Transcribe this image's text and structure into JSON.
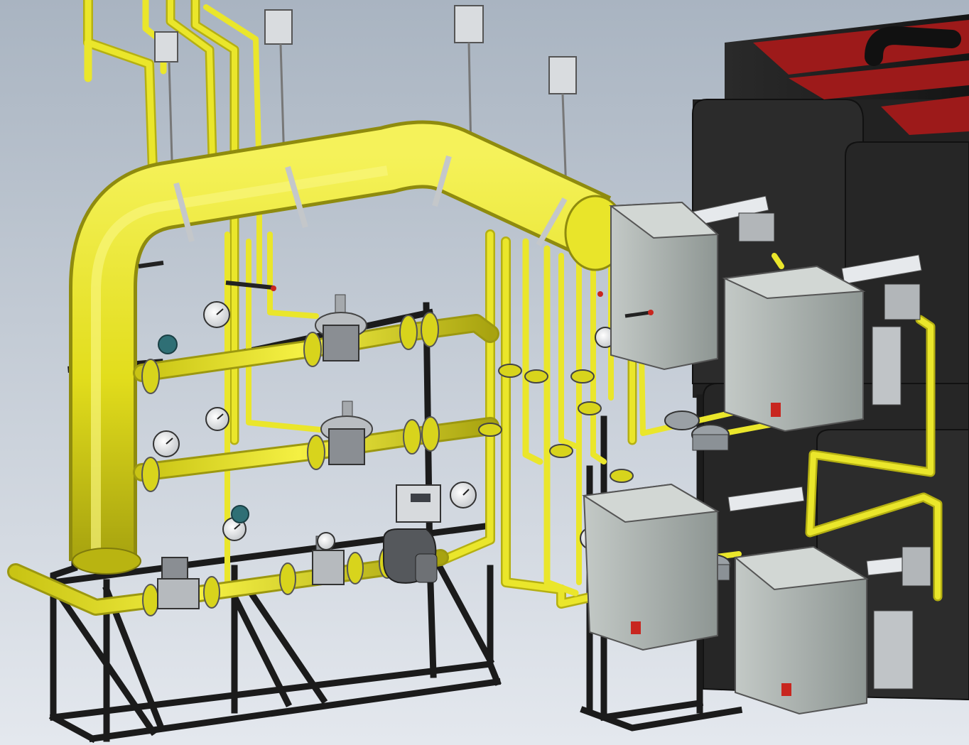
{
  "title": "",
  "colors": {
    "background_top": "#a9b4c1",
    "background_bottom": "#e4e8ee",
    "gas_pipe": "#e6e21a",
    "gas_pipe_dark": "#a09c10",
    "steel_frame": "#1b1b1b",
    "burner_housing": "#9aa29f",
    "burner_housing_light": "#b9c0bd",
    "boiler_body": "#1e1e1e",
    "boiler_top_panel": "#9d1a1a",
    "valve_body": "#8a8e93",
    "gauge_face": "#f3f3f3",
    "indicator_red": "#c8261f"
  },
  "components": {
    "header_pipe": "header-pipe",
    "regulator_lines": [
      "regulator-line-upper",
      "regulator-line-middle",
      "regulator-line-lower"
    ],
    "burners": [
      "burner-1",
      "burner-2",
      "burner-3",
      "burner-4"
    ],
    "boilers": [
      "boiler-upper",
      "boiler-lower"
    ],
    "hangers": [
      "hanger-1",
      "hanger-2",
      "hanger-3",
      "hanger-4"
    ]
  },
  "icons": [
    "pressure-gauge-icon",
    "gas-meter-icon",
    "solenoid-valve-icon",
    "gas-regulator-icon"
  ]
}
